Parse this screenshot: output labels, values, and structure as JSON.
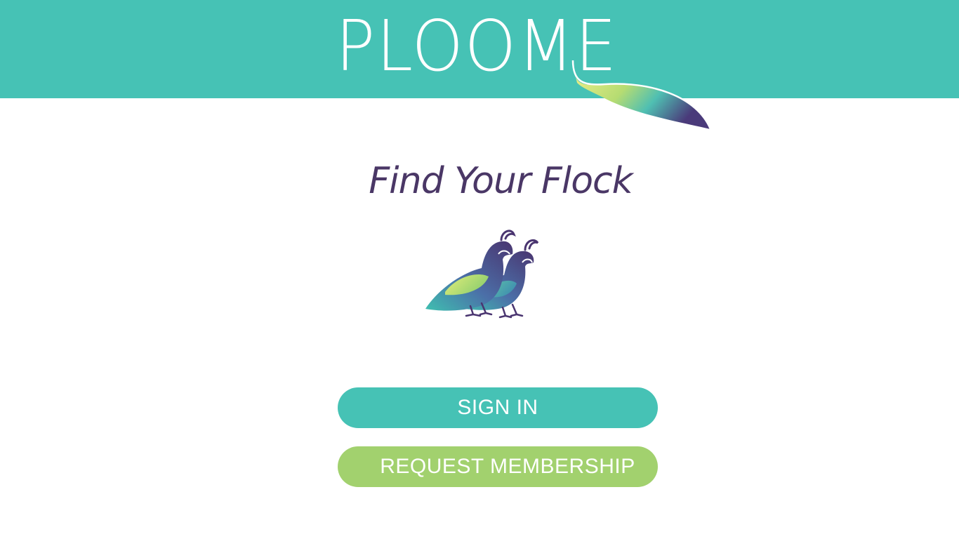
{
  "header": {
    "logo_text": "PLOOME",
    "logo_icon": "feather-icon",
    "background_color": "#46c2b5"
  },
  "main": {
    "tagline": "Find Your Flock",
    "illustration_icon": "quail-pair-icon",
    "tagline_color": "#4a3766"
  },
  "actions": {
    "sign_in_label": "SIGN IN",
    "request_membership_label": "REQUEST MEMBERSHIP",
    "sign_in_color": "#46c2b5",
    "request_membership_color": "#a2d16e"
  }
}
